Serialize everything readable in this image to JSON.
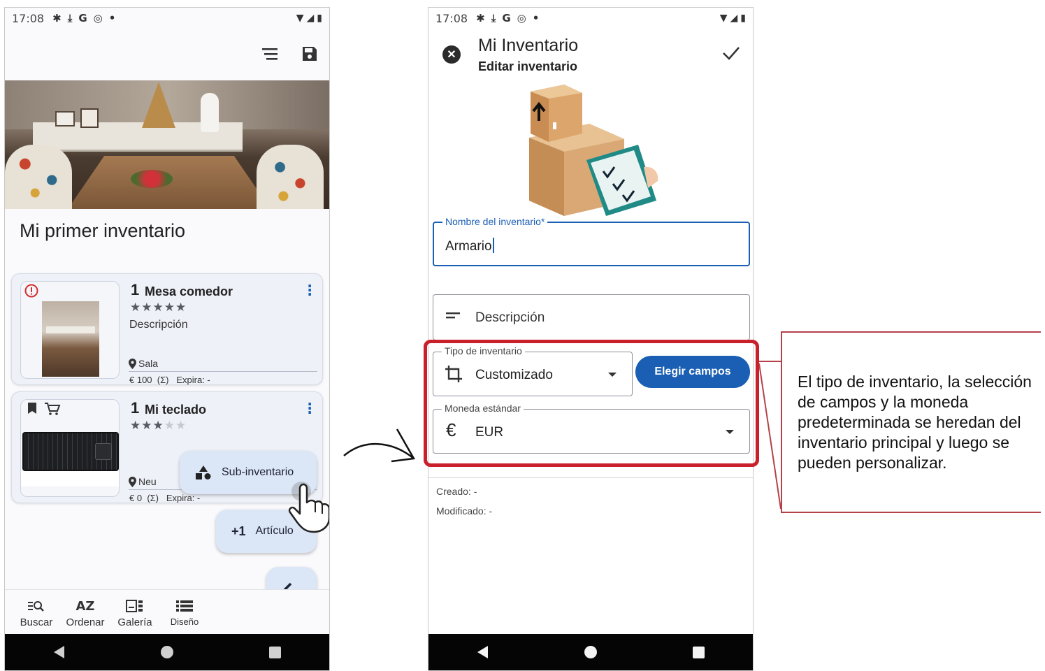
{
  "status": {
    "time": "17:08",
    "icons": [
      "gear-icon",
      "download-icon",
      "google-icon",
      "accessibility-icon",
      "dot-icon"
    ],
    "right_icons": [
      "wifi-icon",
      "signal-icon",
      "battery-icon"
    ]
  },
  "left_screen": {
    "inventory_title": "Mi primer inventario",
    "items": [
      {
        "qty": "1",
        "name": "Mesa comedor",
        "rating": 5,
        "description": "Descripción",
        "location": "Sala",
        "price": "€ 100",
        "sum": "(Σ)",
        "expiry": "Expira: -"
      },
      {
        "qty": "1",
        "name": "Mi teclado",
        "rating": 3,
        "location": "Neu",
        "price": "€ 0",
        "sum": "(Σ)",
        "expiry": "Expira: -"
      }
    ],
    "fab_sub_label": "Sub-inventario",
    "fab_article_prefix": "+1",
    "fab_article_label": "Artículo",
    "bottom_nav": {
      "search": "Buscar",
      "sort": "Ordenar",
      "gallery": "Galería",
      "design": "Diseño",
      "sort_icon_text": "AZ"
    }
  },
  "right_screen": {
    "title": "Mi Inventario",
    "subtitle": "Editar inventario",
    "name_field": {
      "label": "Nombre del inventario*",
      "value": "Armario"
    },
    "description_field": {
      "placeholder": "Descripción"
    },
    "type_field": {
      "label": "Tipo de inventario",
      "value": "Customizado"
    },
    "choose_fields_button": "Elegir campos",
    "currency_field": {
      "label": "Moneda estándar",
      "symbol": "€",
      "value": "EUR"
    },
    "created": "Creado: -",
    "modified": "Modificado: -"
  },
  "annotation": {
    "text": "El tipo de inventario, la selección de campos y la moneda predeterminada se heredan del inventario principal y luego se pueden personalizar."
  },
  "colors": {
    "accent": "#1a5fb4",
    "highlight": "#c9202c",
    "fab": "#dbe6f7",
    "alert": "#d32f2f"
  }
}
